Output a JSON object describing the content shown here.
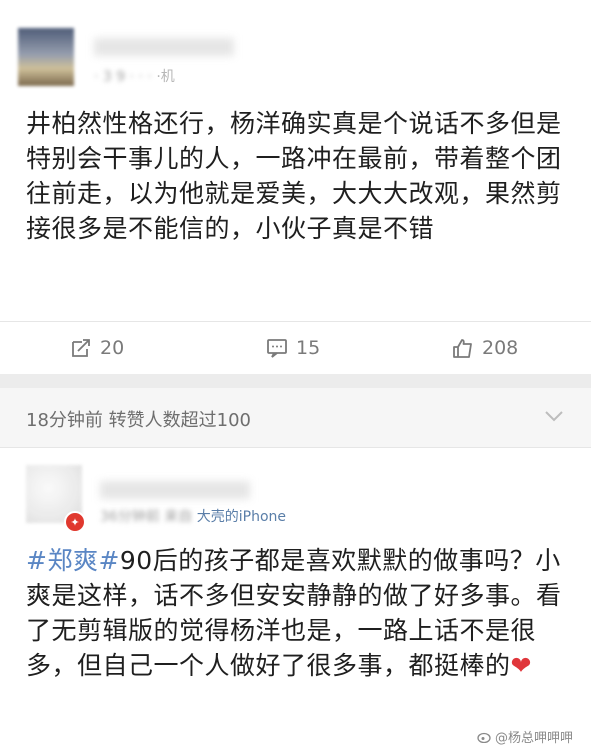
{
  "post1": {
    "author_line": "·机",
    "text": "井柏然性格还行，杨洋确实真是个说话不多但是特别会干事儿的人，一路冲在最前，带着整个团往前走，以为他就是爱美，大大大改观，果然剪接很多是不能信的，小伙子真是不错",
    "actions": {
      "repost": "20",
      "comment": "15",
      "like": "208"
    }
  },
  "info_bar": {
    "text": "18分钟前 转赞人数超过100"
  },
  "post2": {
    "time": "36分钟前",
    "source_prefix": "来自",
    "source": "大壳的iPhone",
    "hashtag": "#郑爽#",
    "text": "90后的孩子都是喜欢默默的做事吗？小爽是这样，话不多但安安静静的做了好多事。看了无剪辑版的觉得杨洋也是，一路上话不是很多，但自己一个人做好了很多事，都挺棒的",
    "emoji": "❤"
  },
  "watermark": {
    "text": "@杨总呷呷呷"
  },
  "colors": {
    "link": "#5a86c4",
    "source": "#5a7ea8",
    "heart": "#e0363b"
  }
}
